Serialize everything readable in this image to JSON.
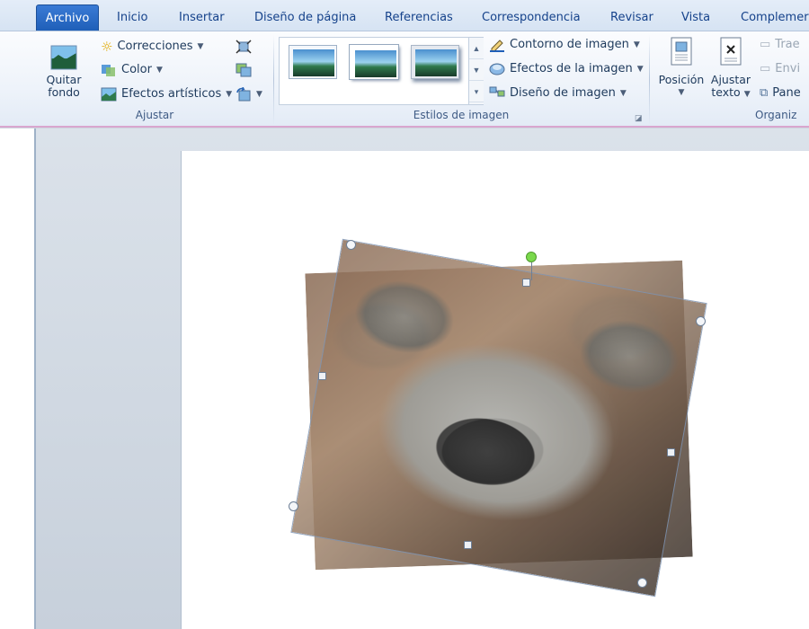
{
  "tabs": [
    "Archivo",
    "Inicio",
    "Insertar",
    "Diseño de página",
    "Referencias",
    "Correspondencia",
    "Revisar",
    "Vista",
    "Complemer"
  ],
  "ribbon": {
    "ajustar": {
      "quitar_fondo_line1": "Quitar",
      "quitar_fondo_line2": "fondo",
      "correcciones": "Correcciones",
      "color": "Color",
      "efectos_artisticos": "Efectos artísticos",
      "group_label": "Ajustar"
    },
    "estilos": {
      "contorno": "Contorno de imagen",
      "efectos": "Efectos de la imagen",
      "diseno": "Diseño de imagen",
      "group_label": "Estilos de imagen"
    },
    "organizar": {
      "posicion": "Posición",
      "ajustar_line1": "Ajustar",
      "ajustar_line2": "texto",
      "traer": "Trae",
      "enviar": "Envi",
      "panel": "Pane",
      "group_label": "Organiz"
    }
  },
  "colors": {
    "file_tab": "#1f5fb8",
    "context_border": "#d9a6cf",
    "rotation_handle": "#7ad94c"
  }
}
